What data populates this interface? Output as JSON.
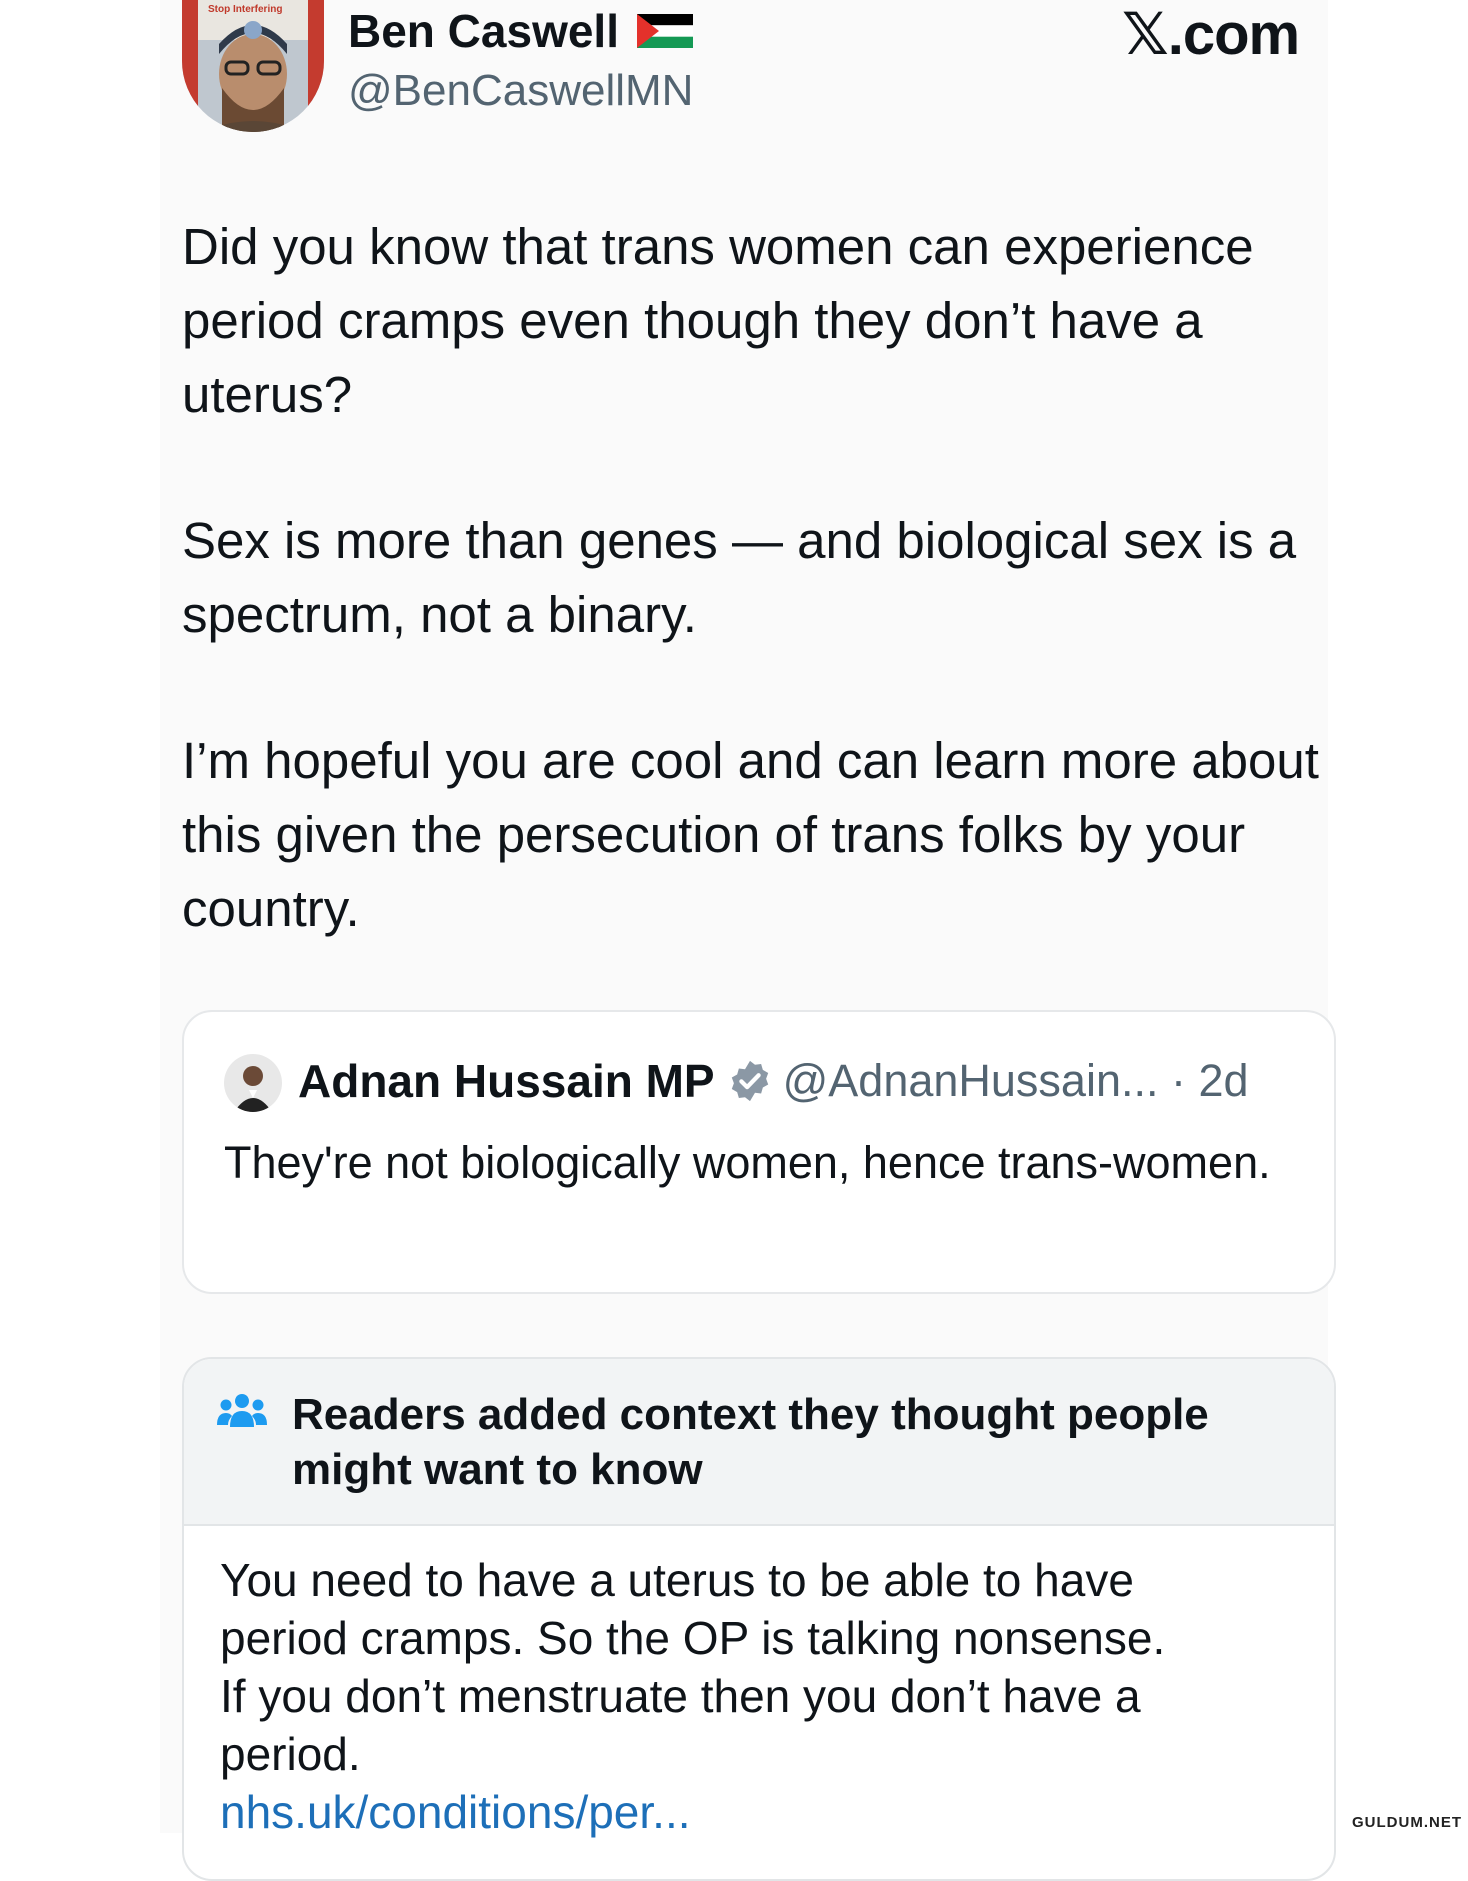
{
  "author": {
    "name": "Ben Caswell",
    "flag_icon": "palestine-flag-icon",
    "handle": "@BenCaswellMN",
    "avatar_sign_text": "Stop Interfering"
  },
  "site_label": "𝕏.com",
  "tweet": {
    "paragraphs": [
      "Did you know that trans women can experience period cramps even though they don’t have a uterus?",
      "Sex is more than genes — and biological sex is a spectrum, not a binary.",
      "I’m hopeful you are cool and can learn more about this given the persecution of trans folks by your country."
    ]
  },
  "quoted_tweet": {
    "name": "Adnan Hussain MP",
    "verified_icon": "verified-badge-icon",
    "handle_meta": "@AdnanHussain... · 2d",
    "text": "They're not biologically women, hence trans-women."
  },
  "community_note": {
    "icon": "people-icon",
    "title": "Readers added context they thought people might want to know",
    "body_lines": [
      "You need to have a uterus to be able to have",
      "period cramps. So the OP is talking nonsense.",
      "If you don’t menstruate then you don’t have a",
      "period."
    ],
    "link_text": "nhs.uk/conditions/per...",
    "link_color": "#1d6fb8"
  },
  "watermark": "GULDUM.NET"
}
